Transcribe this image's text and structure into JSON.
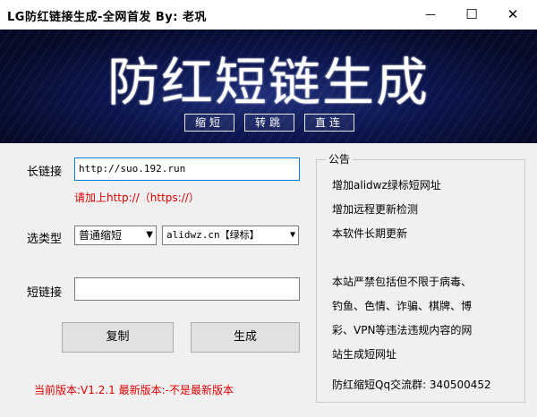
{
  "window": {
    "title": "LG防红链接生成-全网首发  By: 老巩",
    "min_glyph": "—",
    "max_glyph": "☐",
    "close_glyph": "✕"
  },
  "banner": {
    "headline": "防红短链生成",
    "nav": [
      "缩短",
      "转跳",
      "直连"
    ]
  },
  "form": {
    "long_link_label": "长链接",
    "long_link_value": "http://suo.192.run",
    "hint": "请加上http://（https://）",
    "type_label": "选类型",
    "type_select": "普通缩短",
    "domain_select": "alidwz.cn【绿标】",
    "short_link_label": "短链接",
    "short_link_value": "",
    "copy_button": "复制",
    "generate_button": "生成",
    "version_text": "当前版本:V1.2.1 最新版本:-不是最新版本"
  },
  "notice": {
    "title": "公告",
    "lines": [
      "增加alidwz绿标短网址",
      "增加远程更新检测",
      "本软件长期更新",
      "",
      "本站严禁包括但不限于病毒、",
      "钓鱼、色情、诈骗、棋牌、博",
      "彩、VPN等违法违规内容的网",
      "站生成短网址",
      "",
      "防红缩短Qq交流群: 340500452"
    ]
  }
}
